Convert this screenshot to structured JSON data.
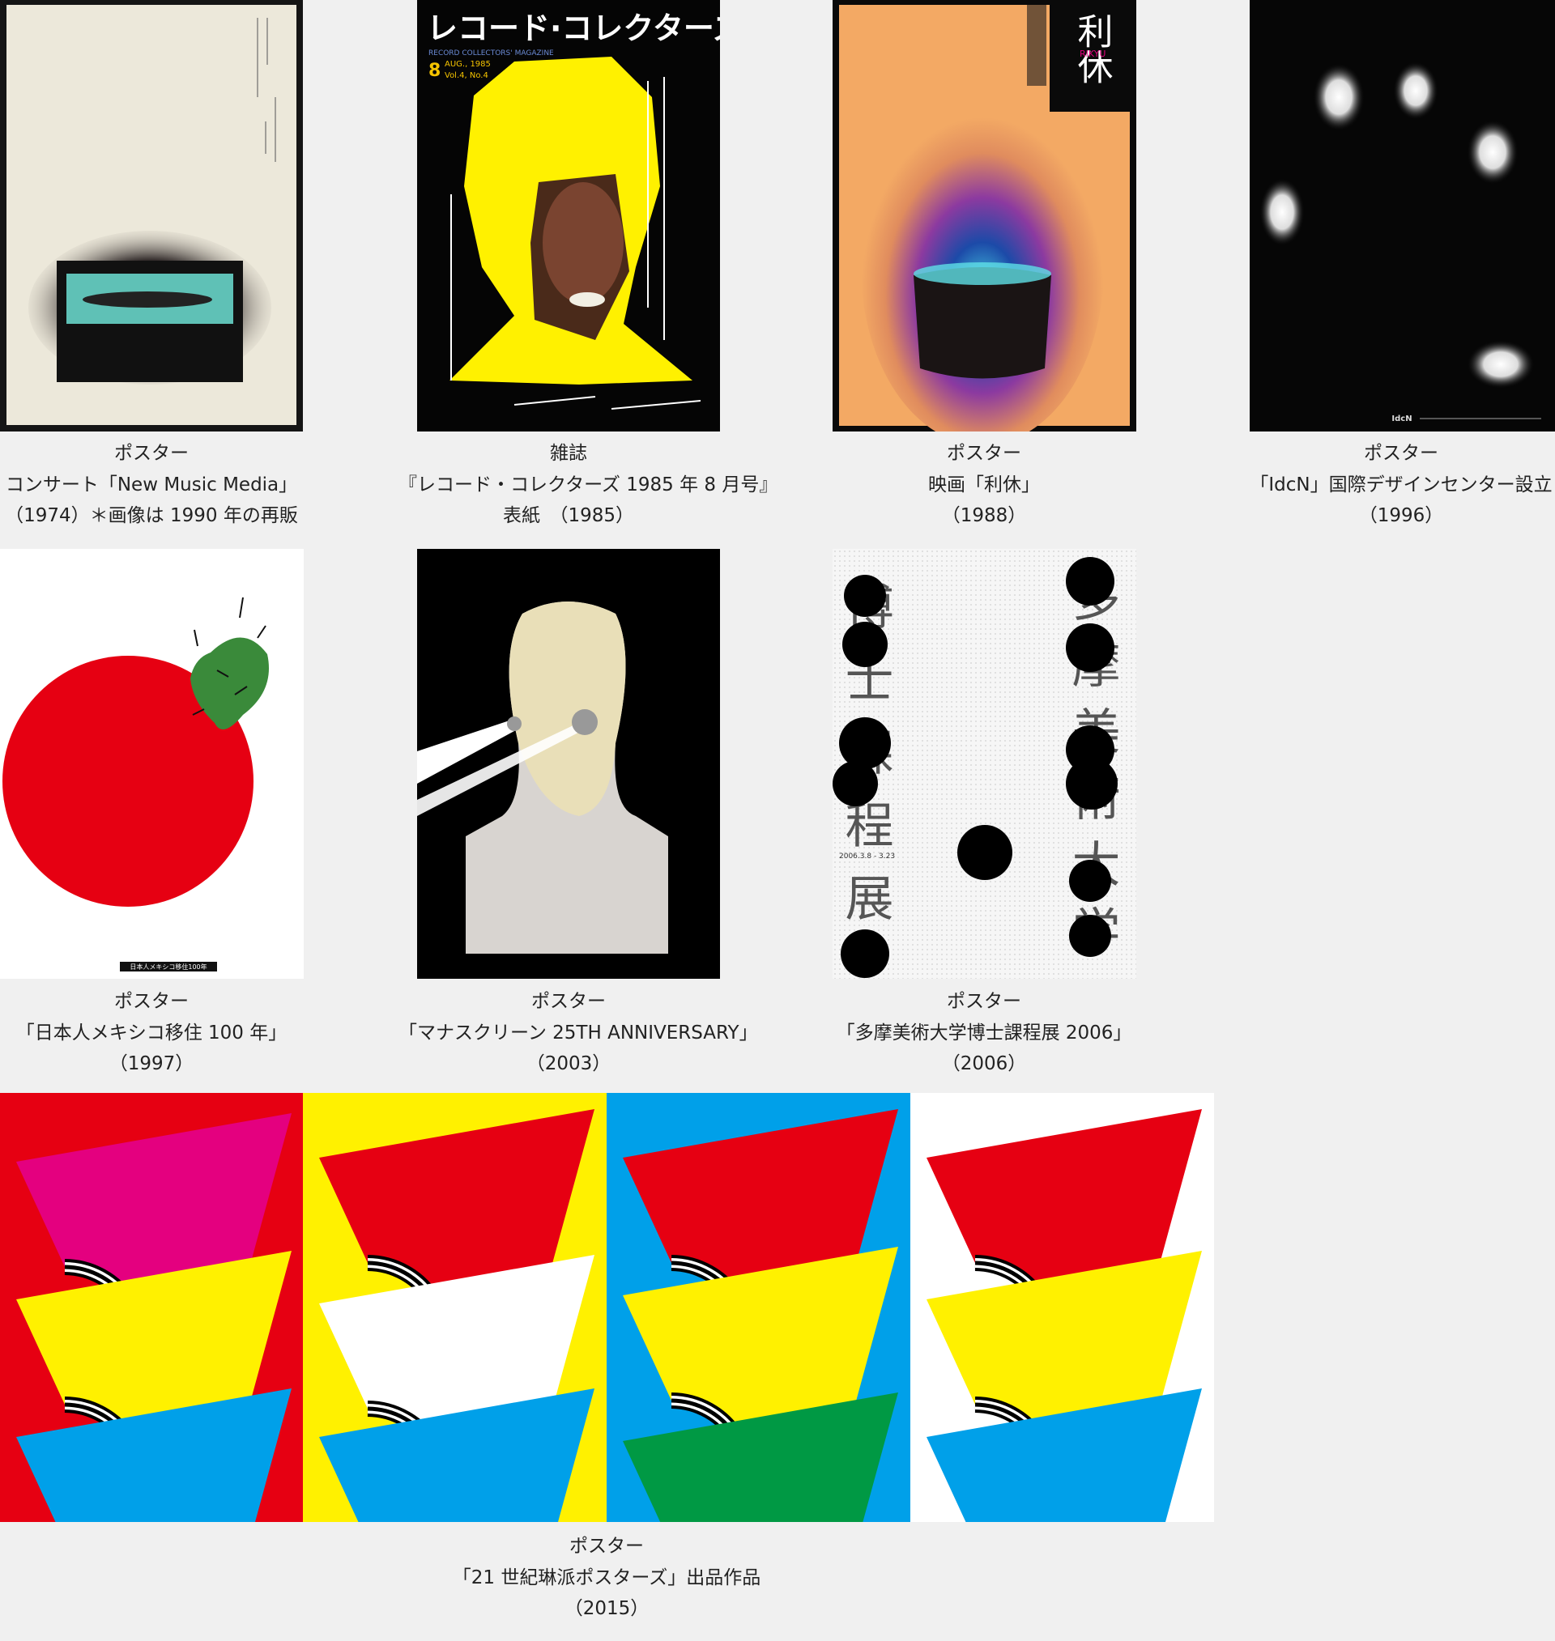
{
  "row1": [
    {
      "type": "ポスター",
      "title": "コンサート「New Music Media」",
      "year": "（1974）＊画像は 1990 年の再販"
    },
    {
      "type": "雑誌",
      "title": "『レコード・コレクターズ 1985 年 8 月号』",
      "year": "表紙　（1985）"
    },
    {
      "type": "ポスター",
      "title": "映画「利休」",
      "year": "（1988）"
    },
    {
      "type": "ポスター",
      "title": "「IdcN」国際デザインセンター設立",
      "year": "（1996）"
    }
  ],
  "row2": [
    {
      "type": "ポスター",
      "title": "「日本人メキシコ移住 100 年」",
      "year": "（1997）"
    },
    {
      "type": "ポスター",
      "title": "「マナスクリーン 25TH ANNIVERSARY」",
      "year": "（2003）"
    },
    {
      "type": "ポスター",
      "title": "「多摩美術大学博士課程展 2006」",
      "year": "（2006）"
    }
  ],
  "row3": {
    "type": "ポスター",
    "title": "「21 世紀琳派ポスターズ」出品作品",
    "year": "（2015）"
  },
  "artwork_text": {
    "magazine_logo": "レコード·コレクターズ",
    "magazine_sub": "RECORD COLLECTORS' MAGAZINE",
    "magazine_issue": "8",
    "magazine_issue_date": "AUG., 1985",
    "magazine_vol": "Vol.4, No.4",
    "rikyu_kanji": "利休",
    "rikyu_roman": "RIKYU",
    "idcn_logo": "IdcN",
    "mexico_label": "日本人メキシコ移住100年",
    "tama_left": "博士課程展",
    "tama_right": "多摩美術大学",
    "tama_dates": "2006.3.8 - 3.23"
  },
  "colors": {
    "background": "#f0f0f0",
    "rinpa_red": "#e60012",
    "rinpa_yellow": "#fff100",
    "rinpa_blue": "#00a0e9",
    "rinpa_magenta": "#e4007f",
    "rinpa_green": "#009944"
  }
}
